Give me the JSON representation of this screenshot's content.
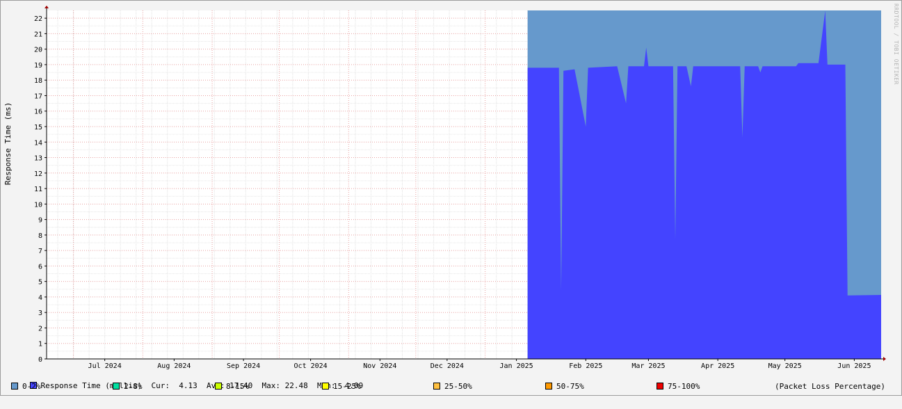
{
  "chart_data": {
    "type": "area",
    "title": "",
    "ylabel": "Response Time (ms)",
    "xlabel": "",
    "watermark": "RRDTOOL / TOBI OETIKER",
    "ylim": [
      0,
      22.5
    ],
    "yticks": [
      0,
      1,
      2,
      3,
      4,
      5,
      6,
      7,
      8,
      9,
      10,
      11,
      12,
      13,
      14,
      15,
      16,
      17,
      18,
      19,
      20,
      21,
      22
    ],
    "xlim": [
      "2024-06-19",
      "2025-06-27"
    ],
    "xticks": [
      {
        "label": "Jul 2024",
        "date": "2024-07-15"
      },
      {
        "label": "Aug 2024",
        "date": "2024-08-15"
      },
      {
        "label": "Sep 2024",
        "date": "2024-09-15"
      },
      {
        "label": "Oct 2024",
        "date": "2024-10-15"
      },
      {
        "label": "Nov 2024",
        "date": "2024-11-15"
      },
      {
        "label": "Dec 2024",
        "date": "2024-12-15"
      },
      {
        "label": "Jan 2025",
        "date": "2025-01-15"
      },
      {
        "label": "Feb 2025",
        "date": "2025-02-15"
      },
      {
        "label": "Mar 2025",
        "date": "2025-03-15"
      },
      {
        "label": "Apr 2025",
        "date": "2025-04-15"
      },
      {
        "label": "May 2025",
        "date": "2025-05-15"
      },
      {
        "label": "Jun 2025",
        "date": "2025-06-15"
      }
    ],
    "month_boundaries": [
      "2024-07-01",
      "2024-08-01",
      "2024-09-01",
      "2024-10-01",
      "2024-11-01",
      "2024-12-01",
      "2025-01-01",
      "2025-02-01",
      "2025-03-01",
      "2025-04-01",
      "2025-05-01",
      "2025-06-01"
    ],
    "series": [
      {
        "name": "Response Time (millis)",
        "color": "#4444ff",
        "points": [
          [
            "2025-01-20",
            18.8
          ],
          [
            "2025-02-01",
            18.8
          ],
          [
            "2025-02-03",
            18.8
          ],
          [
            "2025-02-04",
            4.4
          ],
          [
            "2025-02-05",
            18.6
          ],
          [
            "2025-02-10",
            18.7
          ],
          [
            "2025-02-15",
            15.0
          ],
          [
            "2025-02-16",
            18.8
          ],
          [
            "2025-03-01",
            18.9
          ],
          [
            "2025-03-05",
            16.5
          ],
          [
            "2025-03-06",
            18.9
          ],
          [
            "2025-03-13",
            18.9
          ],
          [
            "2025-03-14",
            20.1
          ],
          [
            "2025-03-15",
            18.9
          ],
          [
            "2025-03-26",
            18.9
          ],
          [
            "2025-03-27",
            7.7
          ],
          [
            "2025-03-28",
            18.9
          ],
          [
            "2025-04-01",
            18.9
          ],
          [
            "2025-04-03",
            17.6
          ],
          [
            "2025-04-04",
            18.9
          ],
          [
            "2025-04-25",
            18.9
          ],
          [
            "2025-04-26",
            14.3
          ],
          [
            "2025-04-27",
            18.9
          ],
          [
            "2025-05-03",
            18.9
          ],
          [
            "2025-05-04",
            18.5
          ],
          [
            "2025-05-05",
            18.9
          ],
          [
            "2025-05-20",
            18.9
          ],
          [
            "2025-05-21",
            19.1
          ],
          [
            "2025-05-30",
            19.1
          ],
          [
            "2025-06-02",
            22.48
          ],
          [
            "2025-06-03",
            19.0
          ],
          [
            "2025-06-11",
            19.0
          ],
          [
            "2025-06-12",
            4.1
          ],
          [
            "2025-06-27",
            4.13
          ]
        ],
        "cur": "4.13",
        "avg": "17.40",
        "max": "22.48",
        "min": "4.09"
      }
    ],
    "loss_band": {
      "name": "0-2%",
      "color": "#6699cc",
      "from": "2025-01-20",
      "to": "2025-06-27",
      "top": 22.5
    },
    "loss_legend": [
      {
        "label": "0-2%",
        "color": "#6699cc"
      },
      {
        "label": "2-8%",
        "color": "#00e0a0"
      },
      {
        "label": "8-15%",
        "color": "#ccff00"
      },
      {
        "label": "15-25%",
        "color": "#ffff00"
      },
      {
        "label": "25-50%",
        "color": "#ffc040"
      },
      {
        "label": "50-75%",
        "color": "#ff9900"
      },
      {
        "label": "75-100%",
        "color": "#ee0000"
      }
    ],
    "legend_text": {
      "series": "Response Time (millis)",
      "cur_label": "Cur:",
      "avg_label": "Avg:",
      "max_label": "Max:",
      "min_label": "Min:",
      "packet_loss_caption": "(Packet Loss Percentage)"
    }
  }
}
